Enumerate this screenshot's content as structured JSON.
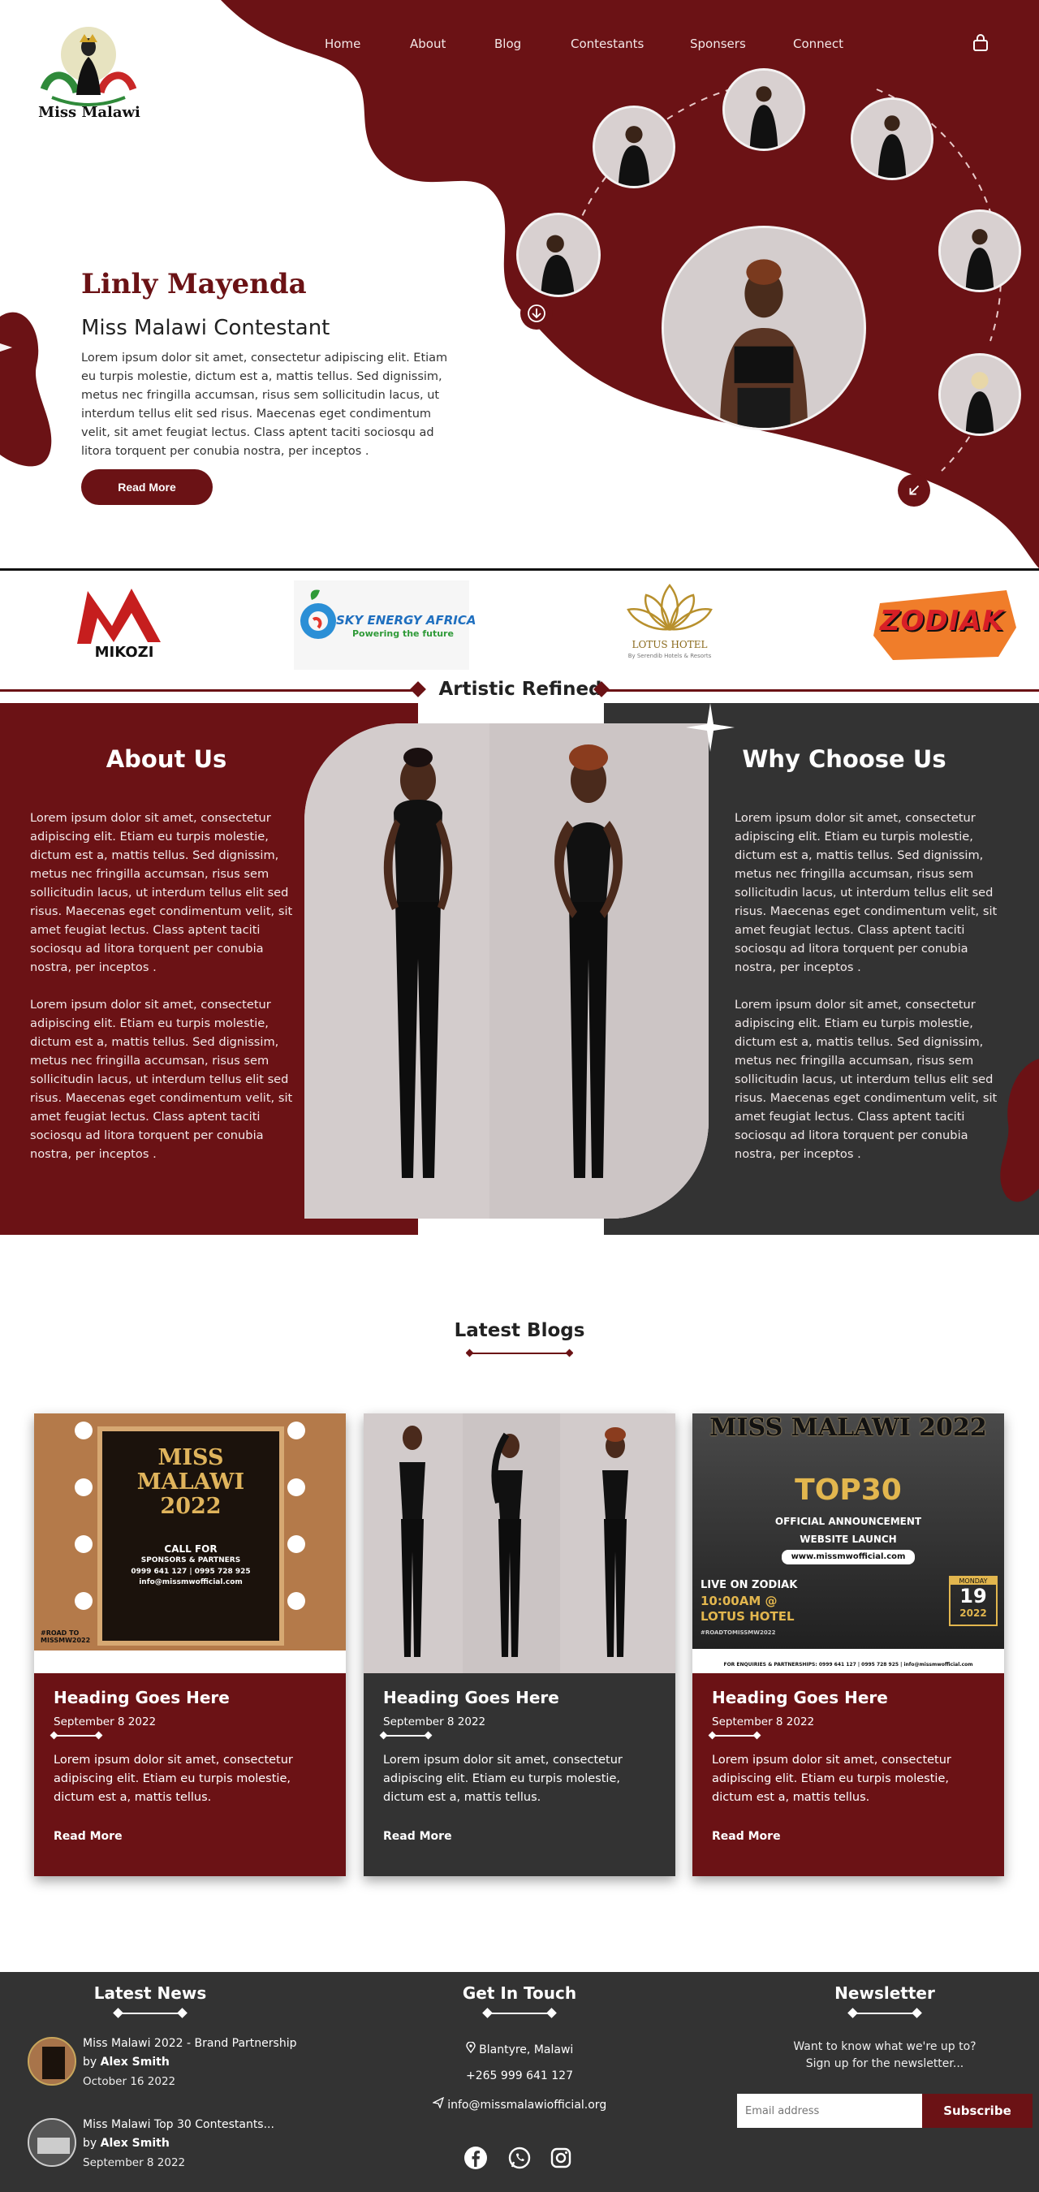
{
  "brand": {
    "name": "Miss Malawi"
  },
  "nav": {
    "items": [
      "Home",
      "About",
      "Blog",
      "Contestants",
      "Sponsers",
      "Connect"
    ],
    "lock_icon": "lock-icon"
  },
  "hero": {
    "name": "Linly Mayenda",
    "subtitle": "Miss Malawi Contestant",
    "text": "Lorem ipsum dolor sit amet, consectetur adipiscing elit. Etiam eu turpis molestie, dictum est a, mattis tellus. Sed dignissim, metus nec fringilla accumsan, risus sem sollicitudin lacus, ut interdum tellus elit sed risus. Maecenas eget condimentum velit, sit amet feugiat lectus. Class aptent taciti sociosqu ad litora torquent per conubia nostra, per inceptos .",
    "button": "Read More"
  },
  "sponsors": {
    "mikozi": "MIKOZI",
    "sky_main": "SKY ENERGY AFRICA",
    "sky_tag": "Powering the future",
    "lotus_main": "LOTUS HOTEL",
    "lotus_tag": "By Serendib Hotels & Resorts",
    "zodiak": "ZODIAK"
  },
  "artistic": {
    "title": "Artistic Refined"
  },
  "about": {
    "title": "About Us",
    "p1": "Lorem ipsum dolor sit amet, consectetur adipiscing elit. Etiam eu turpis molestie, dictum est a, mattis tellus. Sed dignissim, metus nec fringilla accumsan, risus sem sollicitudin lacus, ut interdum tellus elit sed risus. Maecenas eget condimentum velit, sit amet feugiat lectus. Class aptent taciti sociosqu ad litora torquent per conubia nostra, per inceptos .",
    "p2": "Lorem ipsum dolor sit amet, consectetur adipiscing elit. Etiam eu turpis molestie, dictum est a, mattis tellus. Sed dignissim, metus nec fringilla accumsan, risus sem sollicitudin lacus, ut interdum tellus elit sed risus. Maecenas eget condimentum velit, sit amet feugiat lectus. Class aptent taciti sociosqu ad litora torquent per conubia nostra, per inceptos ."
  },
  "why": {
    "title": "Why Choose Us",
    "p1": "Lorem ipsum dolor sit amet, consectetur adipiscing elit. Etiam eu turpis molestie, dictum est a, mattis tellus. Sed dignissim, metus nec fringilla accumsan, risus sem sollicitudin lacus, ut interdum tellus elit sed risus. Maecenas eget condimentum velit, sit amet feugiat lectus. Class aptent taciti sociosqu ad litora torquent per conubia nostra, per inceptos .",
    "p2": "Lorem ipsum dolor sit amet, consectetur adipiscing elit. Etiam eu turpis molestie, dictum est a, mattis tellus. Sed dignissim, metus nec fringilla accumsan, risus sem sollicitudin lacus, ut interdum tellus elit sed risus. Maecenas eget condimentum velit, sit amet feugiat lectus. Class aptent taciti sociosqu ad litora torquent per conubia nostra, per inceptos ."
  },
  "blogs": {
    "title": "Latest Blogs",
    "poster1": {
      "title": "MISS MALAWI 2022",
      "call": "CALL FOR",
      "sub": "SPONSORS & PARTNERS",
      "phone": "0999 641 127 | 0995 728 925",
      "email": "info@missmwofficial.com",
      "tag": "#ROAD TO MISSMW2022"
    },
    "poster3": {
      "title": "MISS MALAWI 2022",
      "top": "TOP30",
      "ann": "OFFICIAL ANNOUNCEMENT",
      "launch": "WEBSITE LAUNCH",
      "site": "www.missmwofficial.com",
      "live": "LIVE ON ZODIAK",
      "time": "10:00AM @",
      "venue": "LOTUS HOTEL",
      "day": "MONDAY",
      "date": "19",
      "year": "2022",
      "tag": "#ROADTOMISSMW2022",
      "contact": "FOR ENQUIRIES & PARTNERSHIPS: 0999 641 127 | 0995 728 925 | info@missmwofficial.com"
    },
    "cards": [
      {
        "heading": "Heading Goes Here",
        "date": "September 8 2022",
        "text": "Lorem ipsum dolor sit amet, consectetur adipiscing elit. Etiam eu turpis molestie, dictum est a, mattis tellus.",
        "link": "Read More"
      },
      {
        "heading": "Heading Goes Here",
        "date": "September 8 2022",
        "text": "Lorem ipsum dolor sit amet, consectetur adipiscing elit. Etiam eu turpis molestie, dictum est a, mattis tellus.",
        "link": "Read More"
      },
      {
        "heading": "Heading Goes Here",
        "date": "September 8 2022",
        "text": "Lorem ipsum dolor sit amet, consectetur adipiscing elit. Etiam eu turpis molestie, dictum est a, mattis tellus.",
        "link": "Read More"
      }
    ]
  },
  "footer": {
    "news_title": "Latest News",
    "news": [
      {
        "title": "Miss Malawi 2022 - Brand Partnership",
        "by": "by",
        "author": "Alex Smith",
        "date": "October 16 2022"
      },
      {
        "title": "Miss Malawi Top 30 Contestants...",
        "by": "by",
        "author": "Alex Smith",
        "date": "September 8 2022"
      }
    ],
    "contact_title": "Get In Touch",
    "address": "Blantyre, Malawi",
    "phone": "+265 999 641 127",
    "email": "info@missmalawiofficial.org",
    "newsletter_title": "Newsletter",
    "newsletter_text_1": "Want to know what we're up to?",
    "newsletter_text_2": "Sign up for the newsletter...",
    "email_placeholder": "Email address",
    "subscribe": "Subscribe",
    "social_icons": [
      "facebook-icon",
      "whatsapp-icon",
      "instagram-icon"
    ]
  },
  "colors": {
    "maroon": "#6b1215",
    "dark": "#333333"
  }
}
